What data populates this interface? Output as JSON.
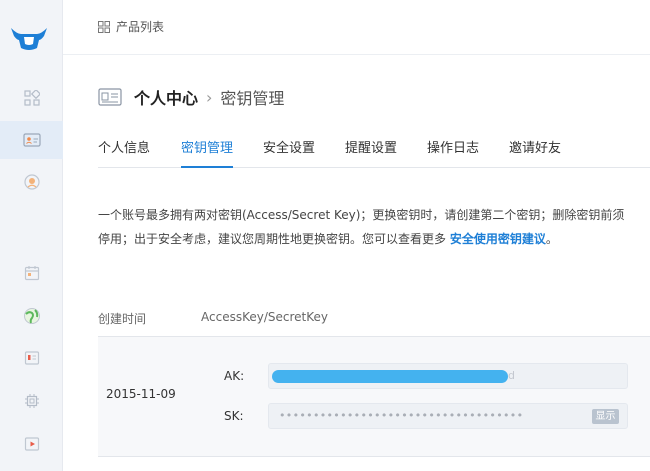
{
  "topbar": {
    "title": "产品列表"
  },
  "breadcrumb": {
    "main": "个人中心",
    "sep": "›",
    "sub": "密钥管理"
  },
  "tabs": [
    "个人信息",
    "密钥管理",
    "安全设置",
    "提醒设置",
    "操作日志",
    "邀请好友"
  ],
  "active_tab": "密钥管理",
  "description": {
    "text": "一个账号最多拥有两对密钥(Access/Secret Key)；更换密钥时，请创建第二个密钥；删除密钥前须停用；出于安全考虑，建议您周期性地更换密钥。您可以查看更多 ",
    "link": "安全使用密钥建议",
    "end": "。"
  },
  "table": {
    "headers": [
      "创建时间",
      "AccessKey/SecretKey"
    ],
    "rows": [
      {
        "date": "2015-11-09",
        "ak_label": "AK:",
        "ak_tail": "d",
        "sk_label": "SK:",
        "sk_masked": "••••••••••••••••••••••••••••••••••••",
        "show_label": "显示"
      }
    ]
  },
  "sidebar": {
    "icons": [
      "logo-icon",
      "dashboard-icon",
      "user-card-icon",
      "support-icon",
      "calendar-icon",
      "globe-icon",
      "mobile-icon",
      "chip-icon",
      "video-icon"
    ]
  },
  "colors": {
    "accent": "#1e7fd6",
    "ak_highlight": "#44b2ef",
    "sidebar_bg": "#f2f4f8"
  }
}
